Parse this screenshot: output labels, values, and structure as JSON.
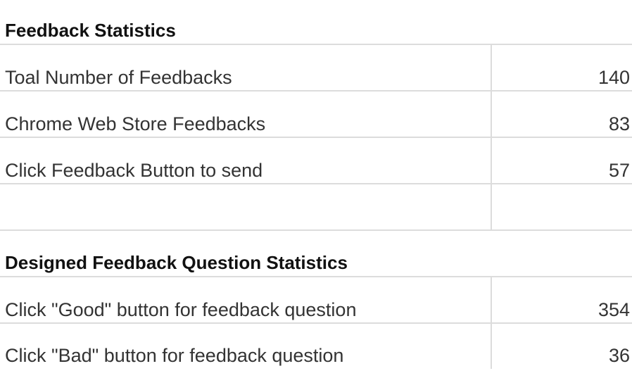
{
  "feedback_statistics": {
    "title": "Feedback Statistics",
    "rows": [
      {
        "label": "Toal Number of Feedbacks",
        "value": "140"
      },
      {
        "label": "Chrome Web Store Feedbacks",
        "value": "83"
      },
      {
        "label": "Click Feedback Button to send",
        "value": "57"
      },
      {
        "label": "",
        "value": ""
      }
    ]
  },
  "question_statistics": {
    "title": "Designed Feedback Question Statistics",
    "rows": [
      {
        "label": "Click \"Good\" button for feedback question",
        "value": "354"
      },
      {
        "label": "Click \"Bad\" button for feedback question",
        "value": "36"
      }
    ]
  }
}
